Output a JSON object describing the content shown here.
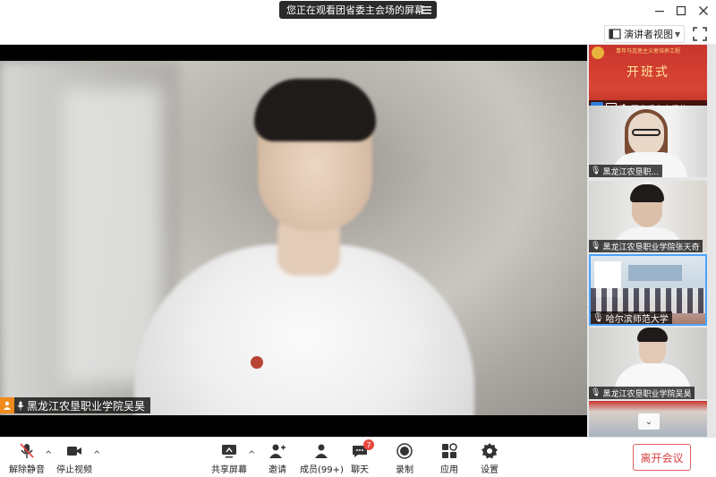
{
  "titlebar": {
    "sharing_notice": "您正在观看团省委主会场的屏幕"
  },
  "view": {
    "mode_label": "演讲者视图"
  },
  "main_video": {
    "participant_name": "黑龙江农垦职业学院吴昊"
  },
  "thumbnails": [
    {
      "name": "团省委主会场的...",
      "banner_top": "青年马克思主义者培养工程",
      "banner_big": "开班式"
    },
    {
      "name": "黑龙江农垦职..."
    },
    {
      "name": "黑龙江农垦职业学院张天奇"
    },
    {
      "name": "哈尔滨师范大学"
    },
    {
      "name": "黑龙江农垦职业学院吴昊"
    },
    {
      "name": ""
    }
  ],
  "toolbar": {
    "unmute_label": "解除静音",
    "stop_video_label": "停止视频",
    "share_screen_label": "共享屏幕",
    "invite_label": "邀请",
    "members_label": "成员(99+)",
    "chat_label": "聊天",
    "chat_badge": "7",
    "record_label": "录制",
    "apps_label": "应用",
    "settings_label": "设置",
    "leave_label": "离开会议"
  },
  "colors": {
    "accent_orange": "#f08a1c",
    "leave_red": "#d84040",
    "badge_red": "#e8493f",
    "highlight_blue": "#4aa3ff"
  }
}
